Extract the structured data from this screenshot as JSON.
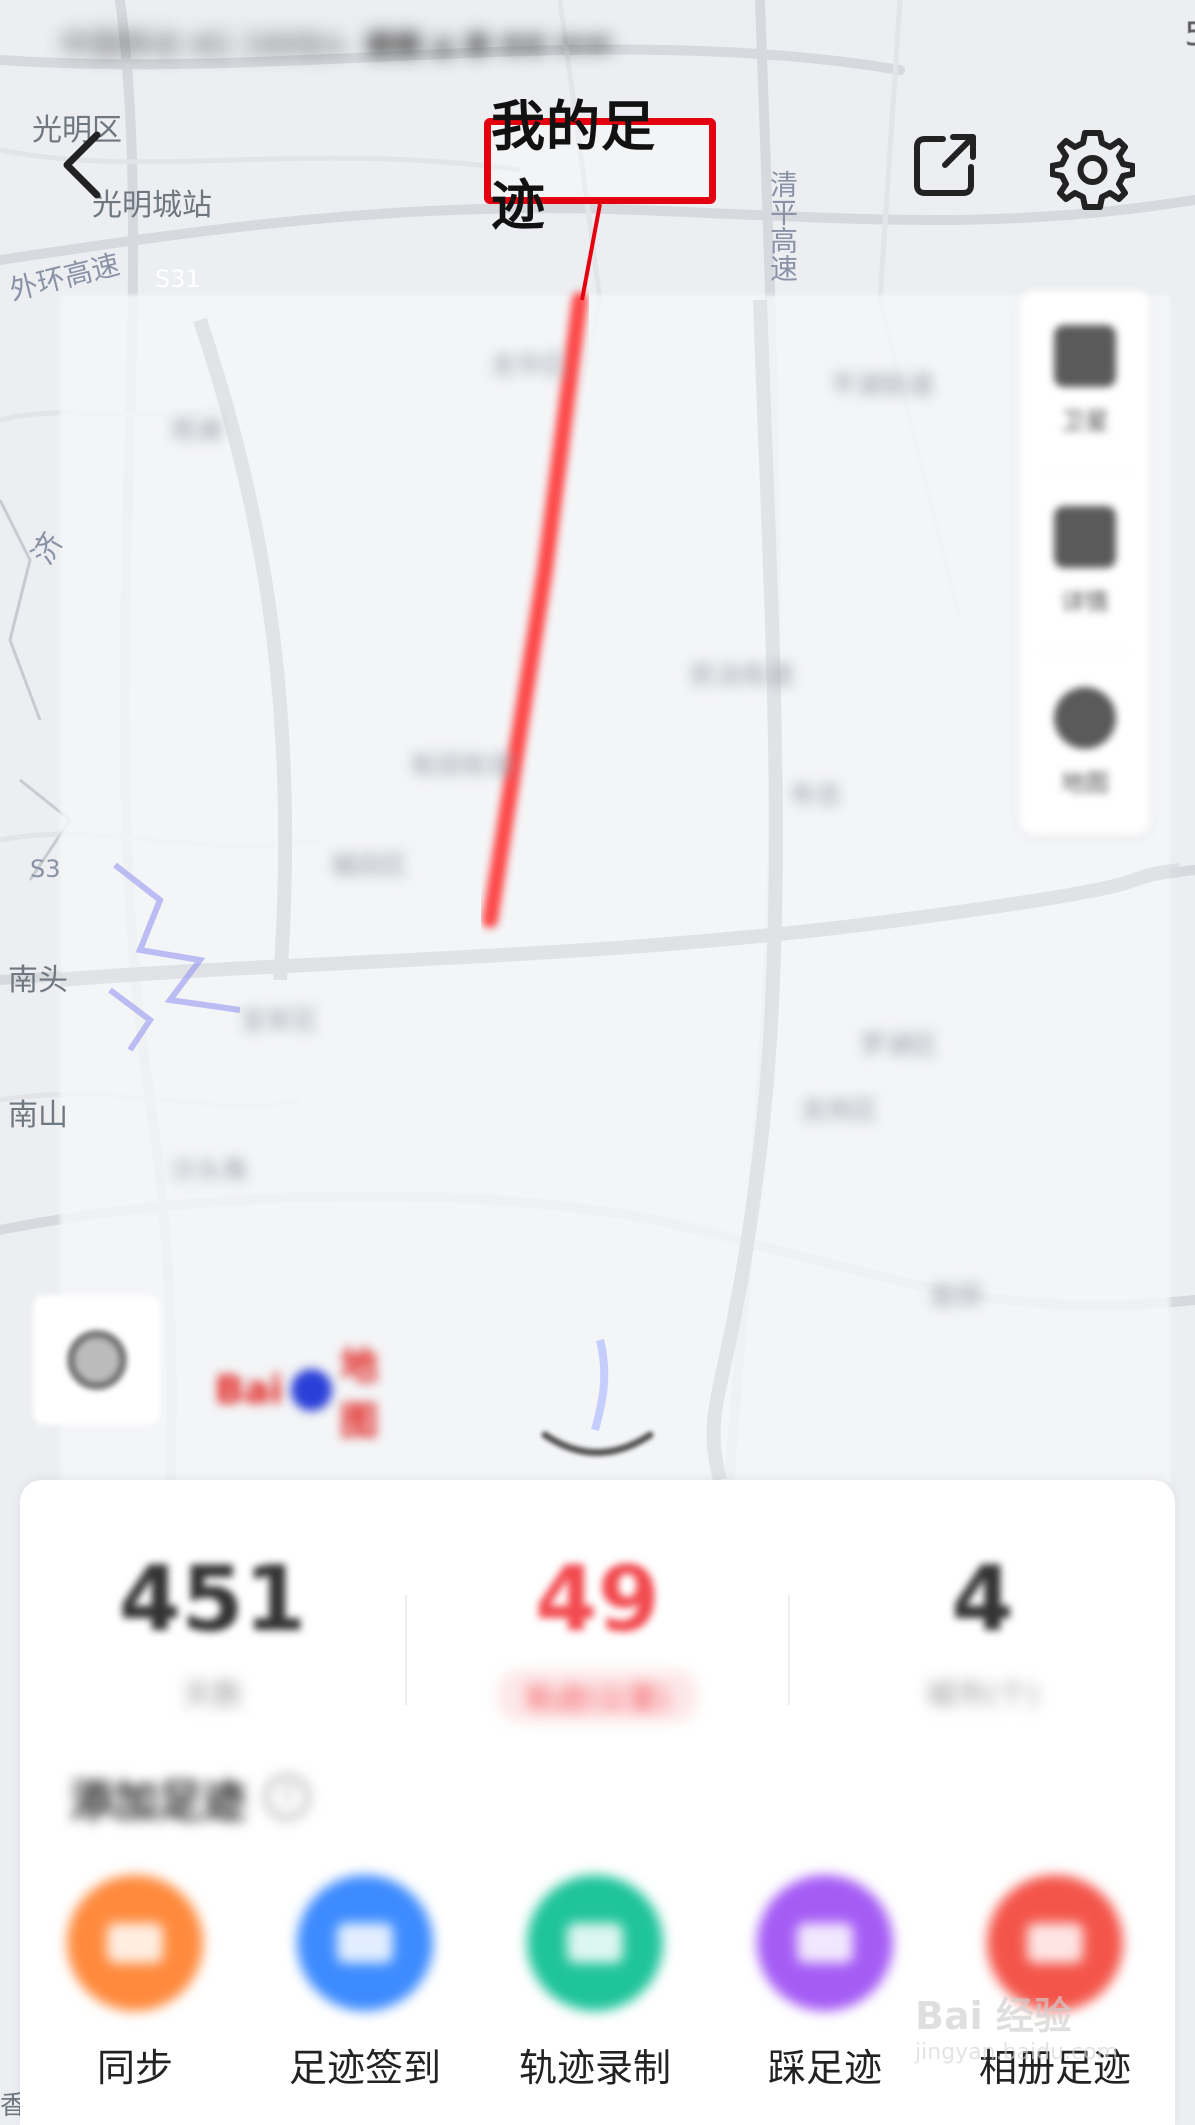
{
  "status_bar": {
    "left_text": "中国移动 4G 16KB/s",
    "time": "5"
  },
  "nav": {
    "title": "我的足迹",
    "back_icon": "back-chevron-icon",
    "share_icon": "share-icon",
    "settings_icon": "gear-icon"
  },
  "highlight_color": "#e4000f",
  "map": {
    "labels": {
      "guangming_district": "光明区",
      "guangming_station": "光明城站",
      "outer_ring": "外环高速",
      "s31": "S31",
      "qingping": "清平高速",
      "s3": "S3",
      "nantou": "南头",
      "nanshan": "南山",
      "ji": "济",
      "xiang": "香"
    },
    "blurred_labels": [
      "龙华区",
      "平湖街道",
      "观澜",
      "民治街道",
      "布吉",
      "坂田街道",
      "福田区",
      "罗湖区",
      "宝安区",
      "龙岗区",
      "沙头角",
      "盐田"
    ]
  },
  "map_tools": [
    {
      "label": "卫星",
      "icon": "layers-icon"
    },
    {
      "label": "详情",
      "icon": "list-icon"
    },
    {
      "label": "地图",
      "icon": "globe-icon"
    }
  ],
  "map_logo": {
    "left": "Bai",
    "right": "地图"
  },
  "stats": [
    {
      "value": "451",
      "label": "天数"
    },
    {
      "value": "49",
      "label": "轨迹(公里)"
    },
    {
      "value": "4",
      "label": "城市(个)"
    }
  ],
  "add_section": {
    "title": "添加足迹",
    "help": "?"
  },
  "actions": [
    {
      "label": "同步",
      "color": "#ff8a3d",
      "icon": "sync-icon"
    },
    {
      "label": "足迹签到",
      "color": "#3d8bff",
      "icon": "checkin-icon"
    },
    {
      "label": "轨迹录制",
      "color": "#1fc49a",
      "icon": "record-icon"
    },
    {
      "label": "踩足迹",
      "color": "#a55cf5",
      "icon": "footprint-icon"
    },
    {
      "label": "相册足迹",
      "color": "#f4554a",
      "icon": "album-icon"
    }
  ],
  "watermark": {
    "text": "Bai 经验",
    "sub": "jingyan.baidu.com"
  }
}
